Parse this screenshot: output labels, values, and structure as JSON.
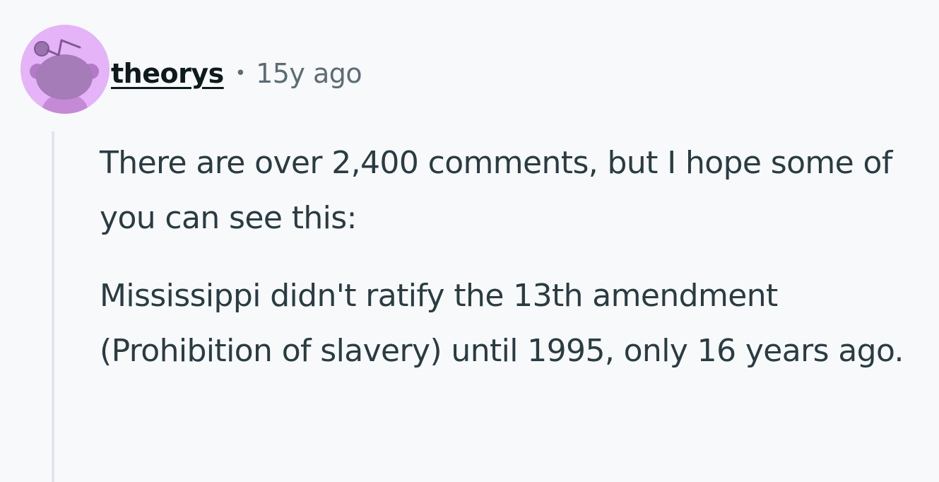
{
  "comment": {
    "author": "theorys",
    "separator": "•",
    "age": "15y ago",
    "avatar_icon": "snoo-avatar-icon",
    "avatar_bg": "#e5b3f7",
    "paragraphs": [
      "There are over 2,400 comments, but I hope some of you can see this:",
      "Mississippi didn't ratify the 13th amendment (Prohibition of slavery) until 1995, only 16 years ago."
    ]
  },
  "colors": {
    "background": "#f7f9fb",
    "username": "#0f1a1c",
    "meta": "#5c6c74",
    "body_text": "#2a3c42",
    "thread_line": "#dfe5ee"
  }
}
